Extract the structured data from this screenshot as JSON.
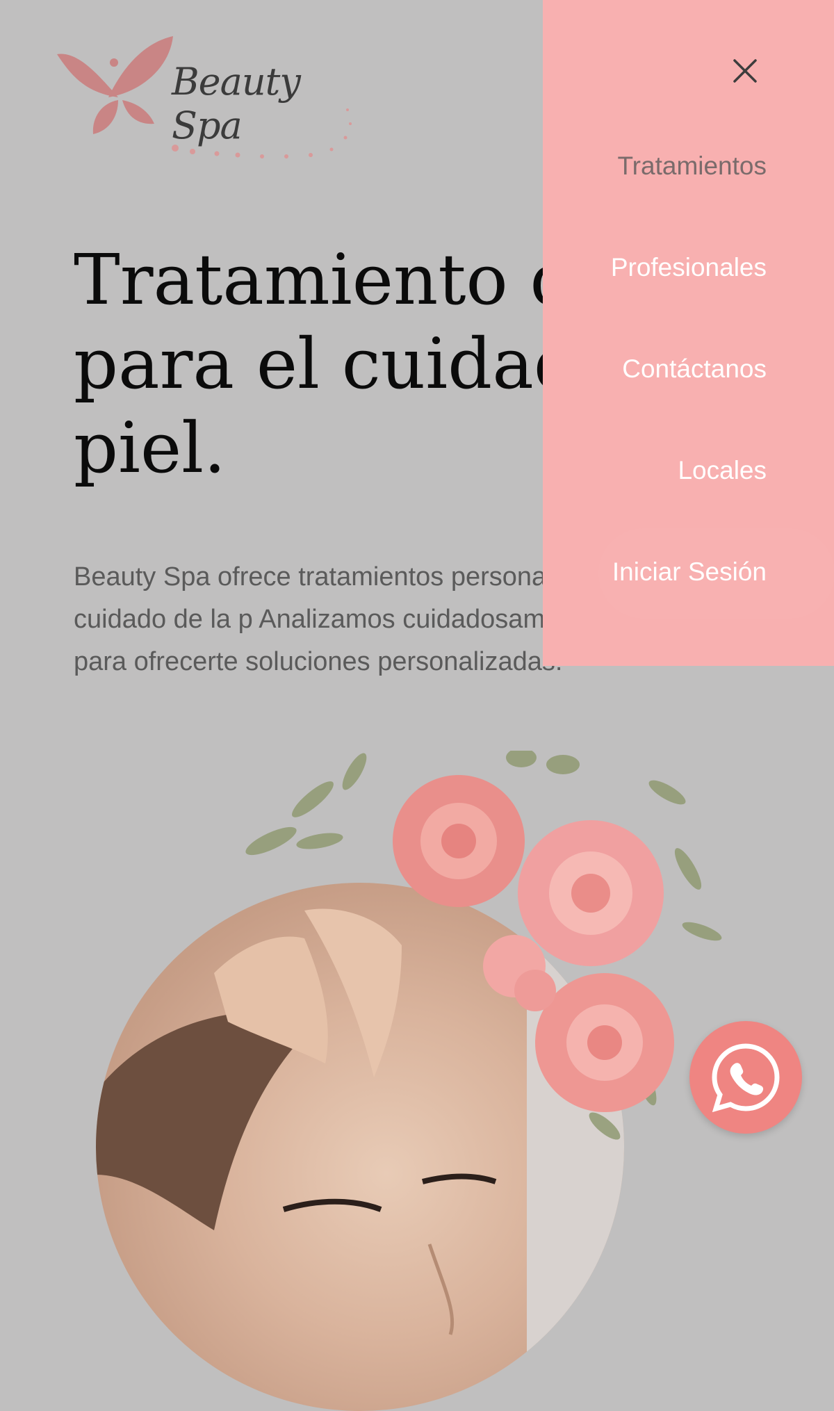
{
  "brand": {
    "name": "Beauty Spa",
    "icon": "butterfly-icon",
    "color": "#d98f8f"
  },
  "hero": {
    "title": "Tratamiento de l\npara el cuidado d\npiel.",
    "description": "Beauty Spa ofrece tratamientos personalizados para el cuidado de la p Analizamos cuidadosamente tu piel para ofrecerte soluciones personalizadas."
  },
  "menu": {
    "close_icon": "close-icon",
    "background": "#f8b0b0",
    "items": [
      {
        "label": "Tratamientos",
        "active": true
      },
      {
        "label": "Profesionales",
        "active": false
      },
      {
        "label": "Contáctanos",
        "active": false
      },
      {
        "label": "Locales",
        "active": false
      },
      {
        "label": "Iniciar Sesión",
        "active": false
      }
    ]
  },
  "whatsapp": {
    "icon": "whatsapp-icon",
    "color": "#ef8582"
  },
  "overlay_color": "#c0bfbf"
}
